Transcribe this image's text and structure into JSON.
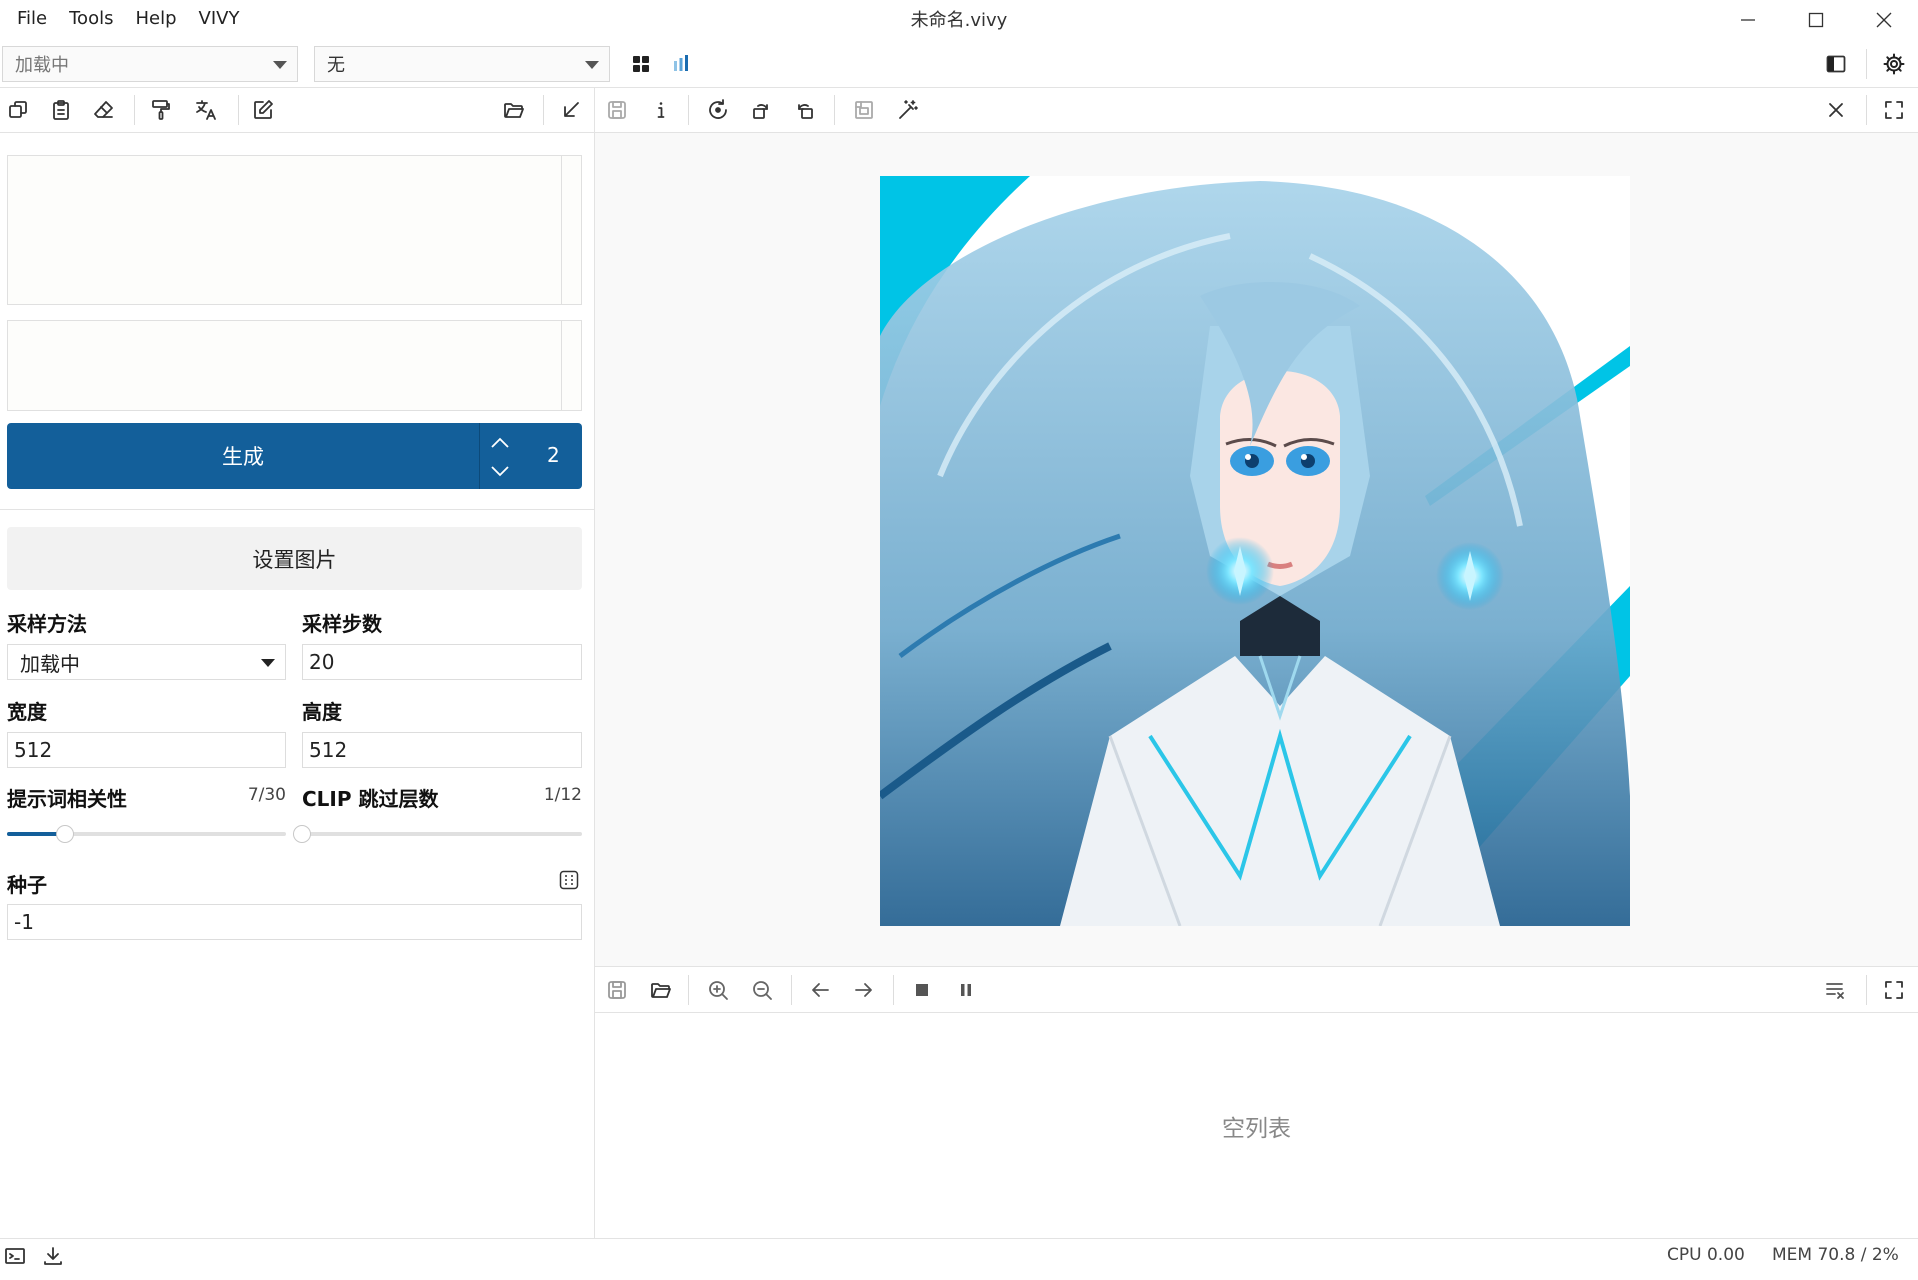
{
  "menu": [
    "File",
    "Tools",
    "Help",
    "VIVY"
  ],
  "window_title": "未命名.vivy",
  "model_select": "加载中",
  "vae_select": "无",
  "generate": {
    "label": "生成",
    "count": "2"
  },
  "set_image_label": "设置图片",
  "sampler": {
    "label": "采样方法",
    "value": "加载中"
  },
  "steps": {
    "label": "采样步数",
    "value": "20"
  },
  "width": {
    "label": "宽度",
    "value": "512"
  },
  "height": {
    "label": "高度",
    "value": "512"
  },
  "cfg": {
    "label": "提示词相关性",
    "readout": "7/30",
    "value": 7,
    "max": 30
  },
  "clip_skip": {
    "label": "CLIP 跳过层数",
    "readout": "1/12",
    "value": 1,
    "max": 12
  },
  "seed": {
    "label": "种子",
    "value": "-1"
  },
  "empty_list_text": "空列表",
  "status": {
    "cpu": "CPU 0.00",
    "mem": "MEM 70.8 / 2%"
  },
  "colors": {
    "accent": "#135f9a",
    "cyan_stripe": "#00c4e6",
    "hair": "#8fc3dc"
  },
  "icons": {
    "toolbar_left": [
      "copy-icon",
      "paste-icon",
      "eraser-icon",
      "paint-roller-icon",
      "translate-icon",
      "edit-icon",
      "folder-open-icon",
      "arrow-down-left-icon"
    ],
    "toolbar_viewer": [
      "save-icon",
      "info-icon",
      "rotate-icon",
      "rotate-left-icon",
      "rotate-right-icon",
      "crop-icon",
      "magic-wand-icon",
      "close-icon",
      "fullscreen-icon"
    ],
    "toolbar_list": [
      "save-icon",
      "folder-open-icon",
      "zoom-in-icon",
      "zoom-out-icon",
      "arrow-left-icon",
      "arrow-right-icon",
      "stop-icon",
      "pause-icon",
      "clear-list-icon",
      "fullscreen-icon"
    ]
  }
}
